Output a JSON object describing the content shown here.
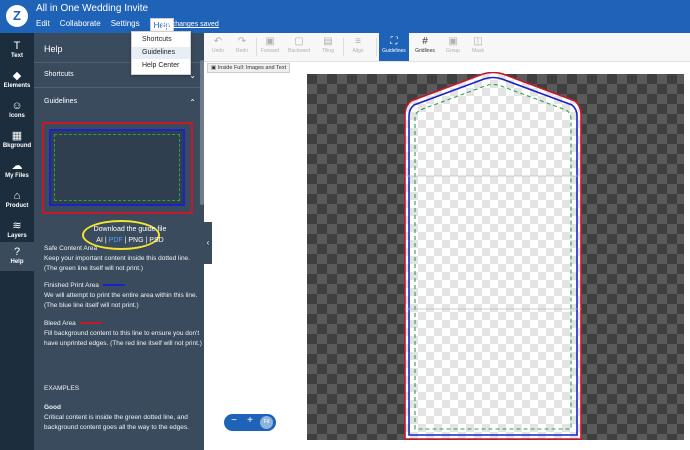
{
  "app": {
    "doc_title": "All in One Wedding Invite",
    "menu": [
      "Edit",
      "Collaborate",
      "Settings",
      "Help"
    ],
    "saved_status": "All changes saved",
    "logo_icon": "zazzle-logo-icon"
  },
  "help_menu": {
    "items": [
      "Shortcuts",
      "Guidelines",
      "Help Center"
    ],
    "highlighted": "Guidelines"
  },
  "rail": {
    "items": [
      {
        "label": "Text",
        "icon": "T"
      },
      {
        "label": "Elements",
        "icon": "◆"
      },
      {
        "label": "Icons",
        "icon": "☺"
      },
      {
        "label": "Bkground",
        "icon": "▦"
      },
      {
        "label": "My Files",
        "icon": "☁"
      },
      {
        "label": "Product",
        "icon": "⌂"
      },
      {
        "label": "Layers",
        "icon": "≋"
      },
      {
        "label": "Help",
        "icon": "?"
      }
    ],
    "active": "Help"
  },
  "panel": {
    "title": "Help",
    "shortcuts_label": "Shortcuts",
    "guidelines_label": "Guidelines",
    "download_label": "Download the guide file",
    "formats": {
      "ai": "AI",
      "pdf": "PDF",
      "png": "PNG",
      "psd": "PSD",
      "sep": "|"
    },
    "safe_title": "Safe Content Area",
    "safe_body": "Keep your important content inside this dotted line. (The green line itself will not print.)",
    "finished_title": "Finished Print Area",
    "finished_body": "We will attempt to print the entire area within this line. (The blue line itself will not print.)",
    "bleed_title": "Bleed Area",
    "bleed_body": "Fill background content to this line to ensure you don't have unprinted edges. (The red line itself will not print.)",
    "examples_label": "EXAMPLES",
    "good_label": "Good",
    "good_body": "Critical content is inside the green dotted line, and background content goes all the way to the edges."
  },
  "toolbar": {
    "tools": [
      {
        "label": "Undo",
        "icon": "↶"
      },
      {
        "label": "Redo",
        "icon": "↷"
      },
      {
        "label": "Forward",
        "icon": "▣"
      },
      {
        "label": "Backward",
        "icon": "▢"
      },
      {
        "label": "Tiling",
        "icon": "▤"
      },
      {
        "label": "Align",
        "icon": "≡"
      },
      {
        "label": "Guidelines",
        "icon": "⛶"
      },
      {
        "label": "Gridlines",
        "icon": "#"
      },
      {
        "label": "Group",
        "icon": "▣"
      },
      {
        "label": "Mask",
        "icon": "◫"
      }
    ],
    "inside_tag": "Inside Full: Images and Text"
  },
  "zoom": {
    "minus": "−",
    "plus": "+",
    "fit": "Fit"
  },
  "colors": {
    "brand": "#1f63b8",
    "panel": "#3a4b5d",
    "bleed": "#c5182b",
    "finished": "#1a23c8",
    "safe": "#2fa14a",
    "highlight": "#f4e22f"
  }
}
